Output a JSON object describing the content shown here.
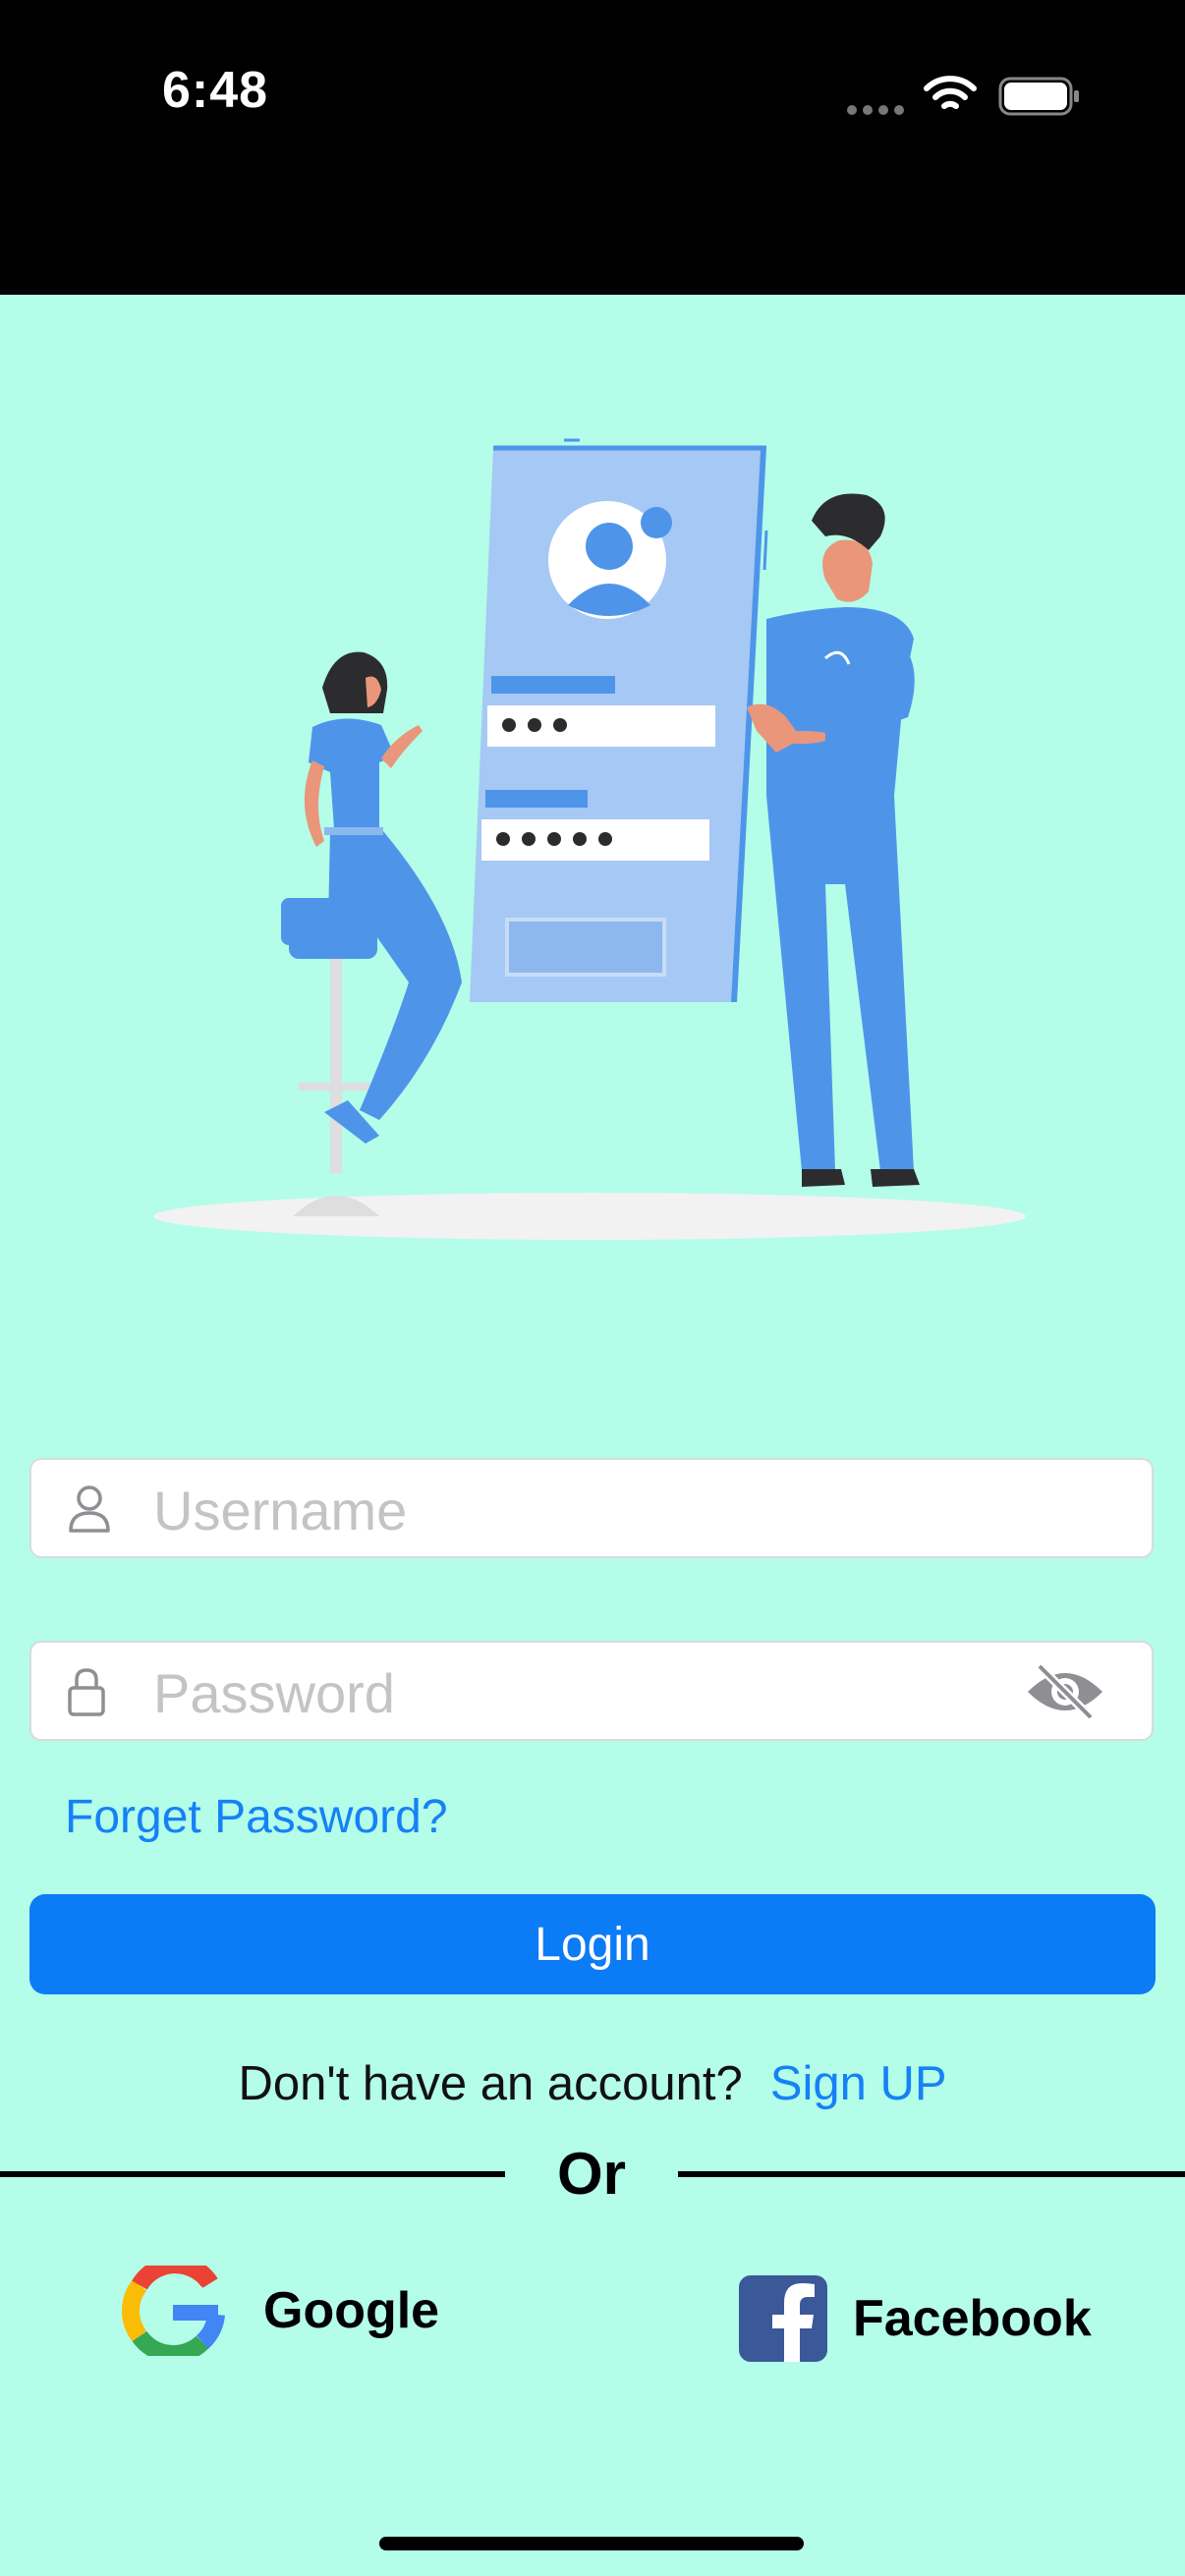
{
  "status_bar": {
    "time": "6:48"
  },
  "illustration": {
    "icon": "login-illustration",
    "colors": {
      "accent": "#4e95ea",
      "panel": "#a6c8f4",
      "hair": "#2c2c2e"
    }
  },
  "form": {
    "username": {
      "placeholder": "Username",
      "value": "",
      "icon": "person-icon"
    },
    "password": {
      "placeholder": "Password",
      "value": "",
      "icon": "lock-icon",
      "toggle_icon": "eye-slash-icon"
    },
    "forgot_label": "Forget Password?",
    "login_label": "Login"
  },
  "signup": {
    "question": "Don't have an account?",
    "link_label": "Sign UP"
  },
  "divider": {
    "label": "Or"
  },
  "social": {
    "google_label": "Google",
    "facebook_label": "Facebook"
  },
  "colors": {
    "background": "#b4fde8",
    "primary": "#0c7bf6",
    "link": "#1681f7"
  }
}
